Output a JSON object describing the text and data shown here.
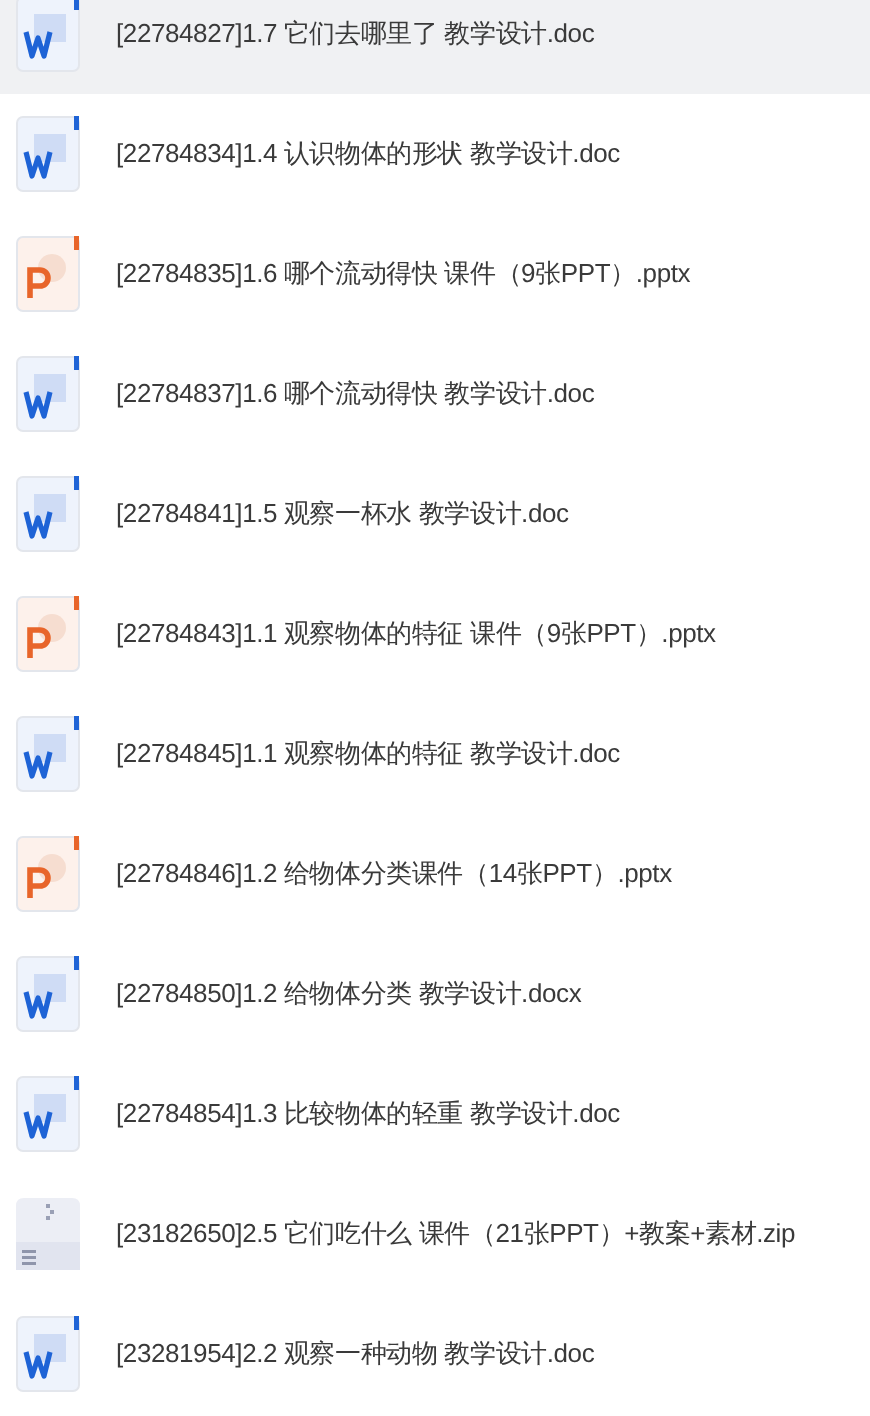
{
  "files": [
    {
      "kind": "word",
      "name": "[22784827]1.7 它们去哪里了 教学设计.doc",
      "selected": true
    },
    {
      "kind": "word",
      "name": "[22784834]1.4 认识物体的形状 教学设计.doc",
      "selected": false
    },
    {
      "kind": "ppt",
      "name": "[22784835]1.6 哪个流动得快 课件（9张PPT）.pptx",
      "selected": false
    },
    {
      "kind": "word",
      "name": "[22784837]1.6 哪个流动得快 教学设计.doc",
      "selected": false
    },
    {
      "kind": "word",
      "name": "[22784841]1.5 观察一杯水 教学设计.doc",
      "selected": false
    },
    {
      "kind": "ppt",
      "name": "[22784843]1.1 观察物体的特征 课件（9张PPT）.pptx",
      "selected": false
    },
    {
      "kind": "word",
      "name": "[22784845]1.1 观察物体的特征 教学设计.doc",
      "selected": false
    },
    {
      "kind": "ppt",
      "name": "[22784846]1.2 给物体分类课件（14张PPT）.pptx",
      "selected": false
    },
    {
      "kind": "word",
      "name": "[22784850]1.2 给物体分类 教学设计.docx",
      "selected": false
    },
    {
      "kind": "word",
      "name": "[22784854]1.3 比较物体的轻重 教学设计.doc",
      "selected": false
    },
    {
      "kind": "zip",
      "name": "[23182650]2.5 它们吃什么 课件（21张PPT）+教案+素材.zip",
      "selected": false
    },
    {
      "kind": "word",
      "name": "[23281954]2.2 观察一种动物 教学设计.doc",
      "selected": false
    }
  ]
}
